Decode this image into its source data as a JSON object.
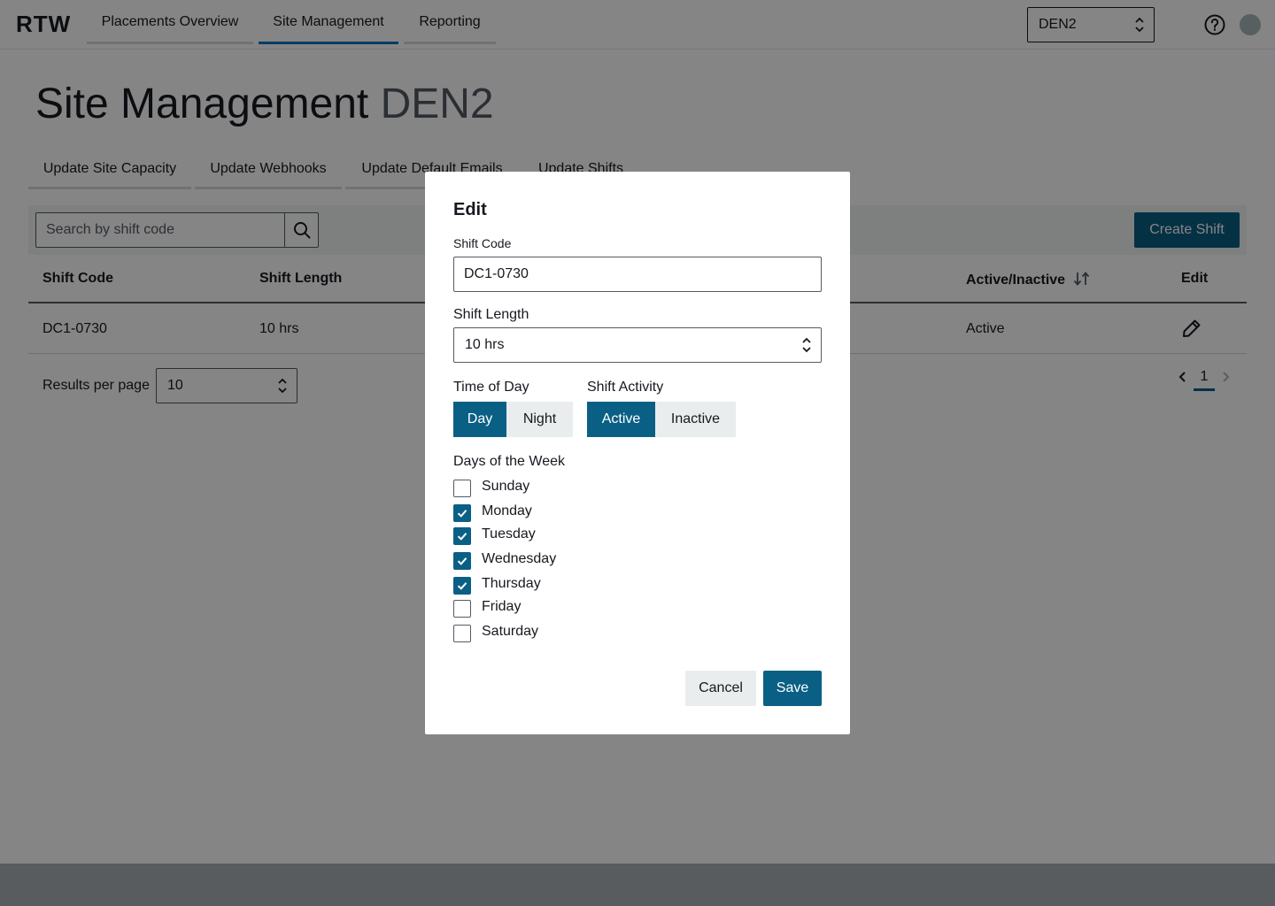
{
  "app": {
    "logo": "RTW"
  },
  "nav": {
    "tabs": [
      {
        "label": "Placements Overview",
        "active": false
      },
      {
        "label": "Site Management",
        "active": true
      },
      {
        "label": "Reporting",
        "active": false
      }
    ],
    "site_select_value": "DEN2",
    "help_icon": "help-circle-icon",
    "avatar_icon": "user-avatar"
  },
  "page": {
    "title": "Site Management",
    "site": "DEN2",
    "subtabs": [
      "Update Site Capacity",
      "Update Webhooks",
      "Update Default Emails",
      "Update Shifts"
    ]
  },
  "toolbar": {
    "search_placeholder": "Search by shift code",
    "create_button": "Create Shift"
  },
  "table": {
    "headers": [
      "Shift Code",
      "Shift Length",
      "Active/Inactive",
      "Edit"
    ],
    "rows": [
      {
        "shift_code": "DC1-0730",
        "shift_length": "10 hrs",
        "status": "Active"
      }
    ]
  },
  "pagination": {
    "results_label": "Results per page",
    "results_value": "10",
    "current_page": "1"
  },
  "modal": {
    "title": "Edit",
    "shift_code_label": "Shift Code",
    "shift_code_value": "DC1-0730",
    "shift_length_label": "Shift Length",
    "shift_length_value": "10 hrs",
    "time_of_day_label": "Time of Day",
    "time_of_day_options": [
      "Day",
      "Night"
    ],
    "time_of_day_selected": "Day",
    "activity_label": "Shift Activity",
    "activity_options": [
      "Active",
      "Inactive"
    ],
    "activity_selected": "Active",
    "days_label": "Days of the Week",
    "days": [
      {
        "name": "Sunday",
        "checked": false
      },
      {
        "name": "Monday",
        "checked": true
      },
      {
        "name": "Tuesday",
        "checked": true
      },
      {
        "name": "Wednesday",
        "checked": true
      },
      {
        "name": "Thursday",
        "checked": true
      },
      {
        "name": "Friday",
        "checked": false
      },
      {
        "name": "Saturday",
        "checked": false
      }
    ],
    "cancel_label": "Cancel",
    "save_label": "Save"
  },
  "colors": {
    "primary": "#0a5f85",
    "tab_underline": "#0073bb",
    "overlay": "rgba(0,0,0,0.48)",
    "text": "#16191f"
  }
}
